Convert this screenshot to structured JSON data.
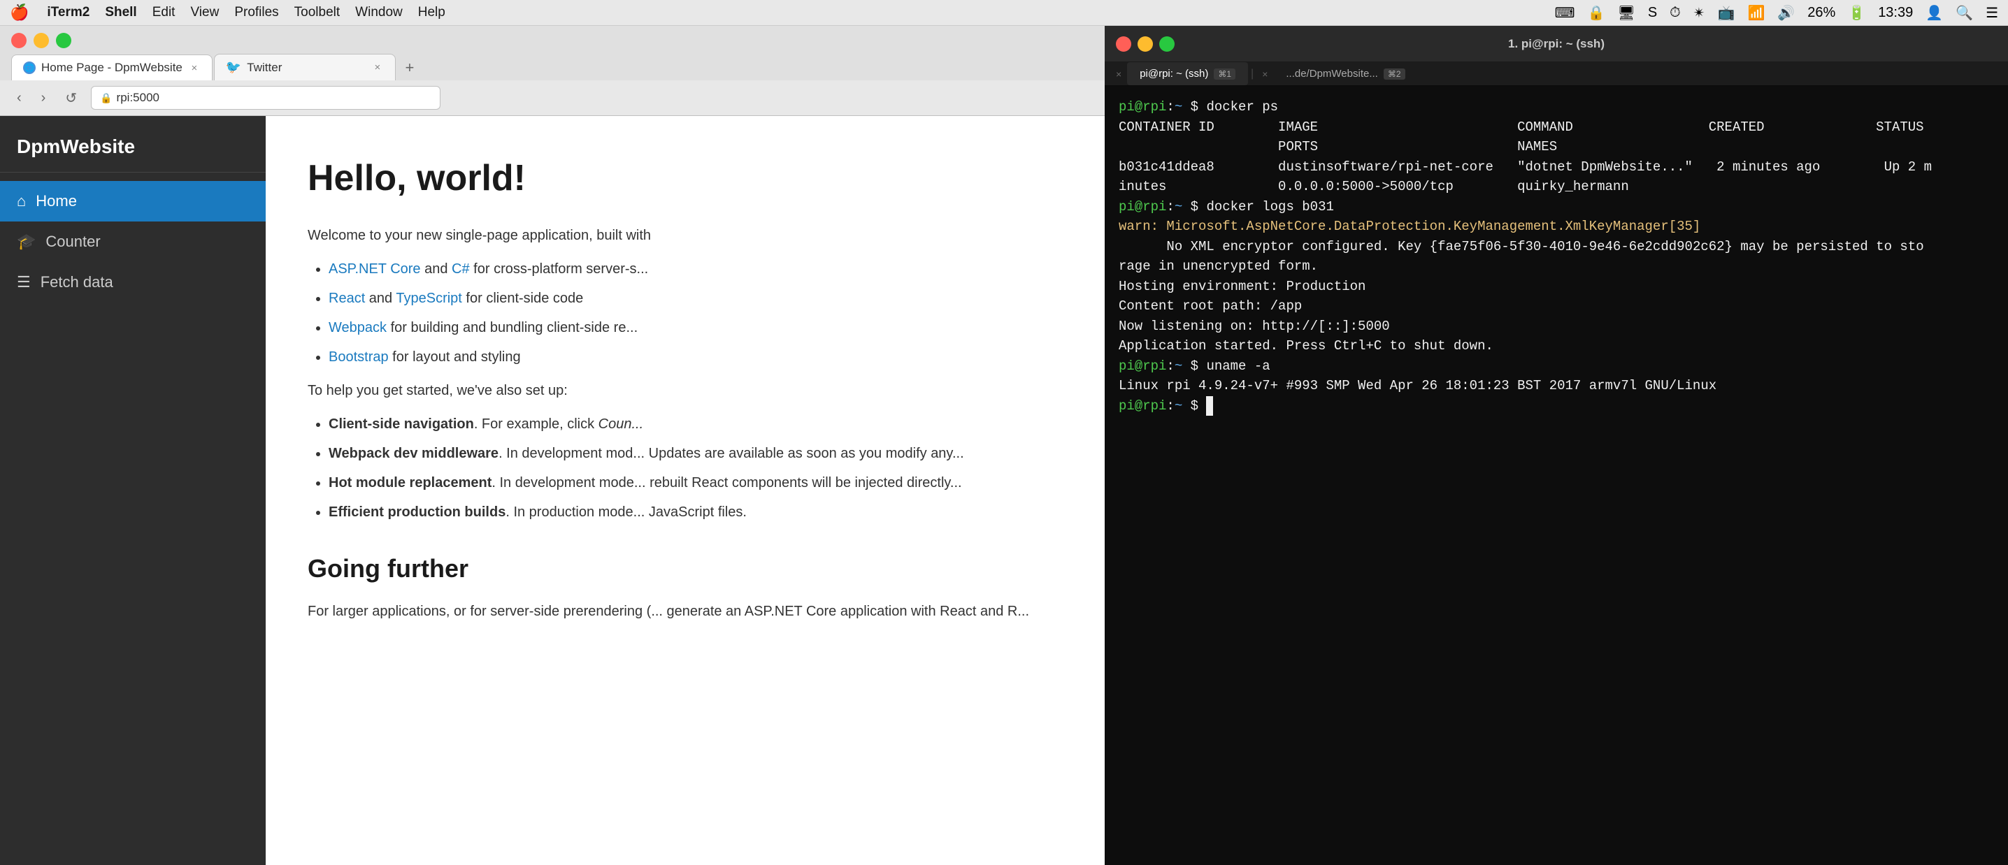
{
  "menubar": {
    "apple": "🍎",
    "items": [
      "iTerm2",
      "Shell",
      "Edit",
      "View",
      "Profiles",
      "Toolbelt",
      "Window",
      "Help"
    ],
    "right_icons": [
      "⌨",
      "🔒",
      "🖥",
      "S",
      "⏱",
      "🕐",
      "✈",
      "📶",
      "🔊",
      "26%",
      "🔋",
      "13:39",
      "👤",
      "🔍",
      "☰"
    ]
  },
  "browser": {
    "tabs": [
      {
        "id": "home",
        "title": "Home Page - DpmWebsite",
        "favicon": "globe",
        "active": true
      },
      {
        "id": "twitter",
        "title": "Twitter",
        "favicon": "twitter",
        "active": false
      }
    ],
    "address": "rpi:5000",
    "address_icon": "🔒"
  },
  "sidebar": {
    "brand": "DpmWebsite",
    "items": [
      {
        "id": "home",
        "label": "Home",
        "icon": "⌂",
        "active": true
      },
      {
        "id": "counter",
        "label": "Counter",
        "icon": "🎓",
        "active": false
      },
      {
        "id": "fetchdata",
        "label": "Fetch data",
        "icon": "☰",
        "active": false
      }
    ]
  },
  "main": {
    "heading": "Hello, world!",
    "intro": "Welcome to your new single-page application, built with",
    "bullets1": [
      {
        "links": [
          {
            "text": "ASP.NET Core",
            "href": true
          },
          {
            "text": " and "
          },
          {
            "text": "C#",
            "href": true
          }
        ],
        "suffix": " for cross-platform server-s..."
      },
      {
        "links": [
          {
            "text": "React",
            "href": true
          },
          {
            "text": " and "
          },
          {
            "text": "TypeScript",
            "href": true
          }
        ],
        "suffix": " for client-side code"
      },
      {
        "links": [
          {
            "text": "Webpack",
            "href": true
          }
        ],
        "suffix": " for building and bundling client-side re..."
      },
      {
        "links": [
          {
            "text": "Bootstrap",
            "href": true
          }
        ],
        "suffix": " for layout and styling"
      }
    ],
    "setup_intro": "To help you get started, we've also set up:",
    "bullets2": [
      {
        "bold": "Client-side navigation",
        "text": ". For example, click Coun..."
      },
      {
        "bold": "Webpack dev middleware",
        "text": ". In development mod... Updates are available as soon as you modify any..."
      },
      {
        "bold": "Hot module replacement",
        "text": ". In development mode... rebuilt React components will be injected directly..."
      },
      {
        "bold": "Efficient production builds",
        "text": ". In production mode... JavaScript files."
      }
    ],
    "further_heading": "Going further",
    "further_text": "For larger applications, or for server-side prerendering (... generate an ASP.NET Core application with React and R..."
  },
  "terminal": {
    "window_title": "1. pi@rpi: ~ (ssh)",
    "tabs": [
      {
        "id": "tab1",
        "label": "pi@rpi: ~ (ssh)",
        "kbd": "⌘1",
        "active": true
      },
      {
        "id": "tab2",
        "label": "...de/DpmWebsite...",
        "kbd": "⌘2",
        "active": false
      }
    ],
    "lines": [
      {
        "type": "prompt",
        "text": "pi@rpi:~ $ docker ps"
      },
      {
        "type": "header",
        "text": "CONTAINER ID        IMAGE                         COMMAND                 CREATED              STATUS"
      },
      {
        "type": "header2",
        "text": "                    PORTS                         NAMES"
      },
      {
        "type": "output",
        "text": "b031c41ddea8        dustinsoftware/rpi-net-core   \"dotnet DpmWebsite...\"   2 minutes ago        Up 2 m"
      },
      {
        "type": "output",
        "text": "inutes              0.0.0.0:5000->5000/tcp        quirky_hermann"
      },
      {
        "type": "prompt",
        "text": "pi@rpi:~ $ docker logs b031"
      },
      {
        "type": "warn",
        "text": "warn: Microsoft.AspNetCore.DataProtection.KeyManagement.XmlKeyManager[35]"
      },
      {
        "type": "output",
        "text": "      No XML encryptor configured. Key {fae75f06-5f30-4010-9e46-6e2cdd902c62} may be persisted to sto"
      },
      {
        "type": "output",
        "text": "rage in unencrypted form."
      },
      {
        "type": "output",
        "text": "Hosting environment: Production"
      },
      {
        "type": "output",
        "text": "Content root path: /app"
      },
      {
        "type": "output",
        "text": "Now listening on: http://[::]:5000"
      },
      {
        "type": "output",
        "text": "Application started. Press Ctrl+C to shut down."
      },
      {
        "type": "prompt",
        "text": "pi@rpi:~ $ uname -a"
      },
      {
        "type": "output",
        "text": "Linux rpi 4.9.24-v7+ #993 SMP Wed Apr 26 18:01:23 BST 2017 armv7l GNU/Linux"
      },
      {
        "type": "prompt_cursor",
        "text": "pi@rpi:~ $ "
      }
    ]
  },
  "labels": {
    "nav_back": "‹",
    "nav_forward": "›",
    "nav_refresh": "↺",
    "tab_close": "×",
    "tab_new": "+",
    "terminal_close_tab": "×"
  }
}
